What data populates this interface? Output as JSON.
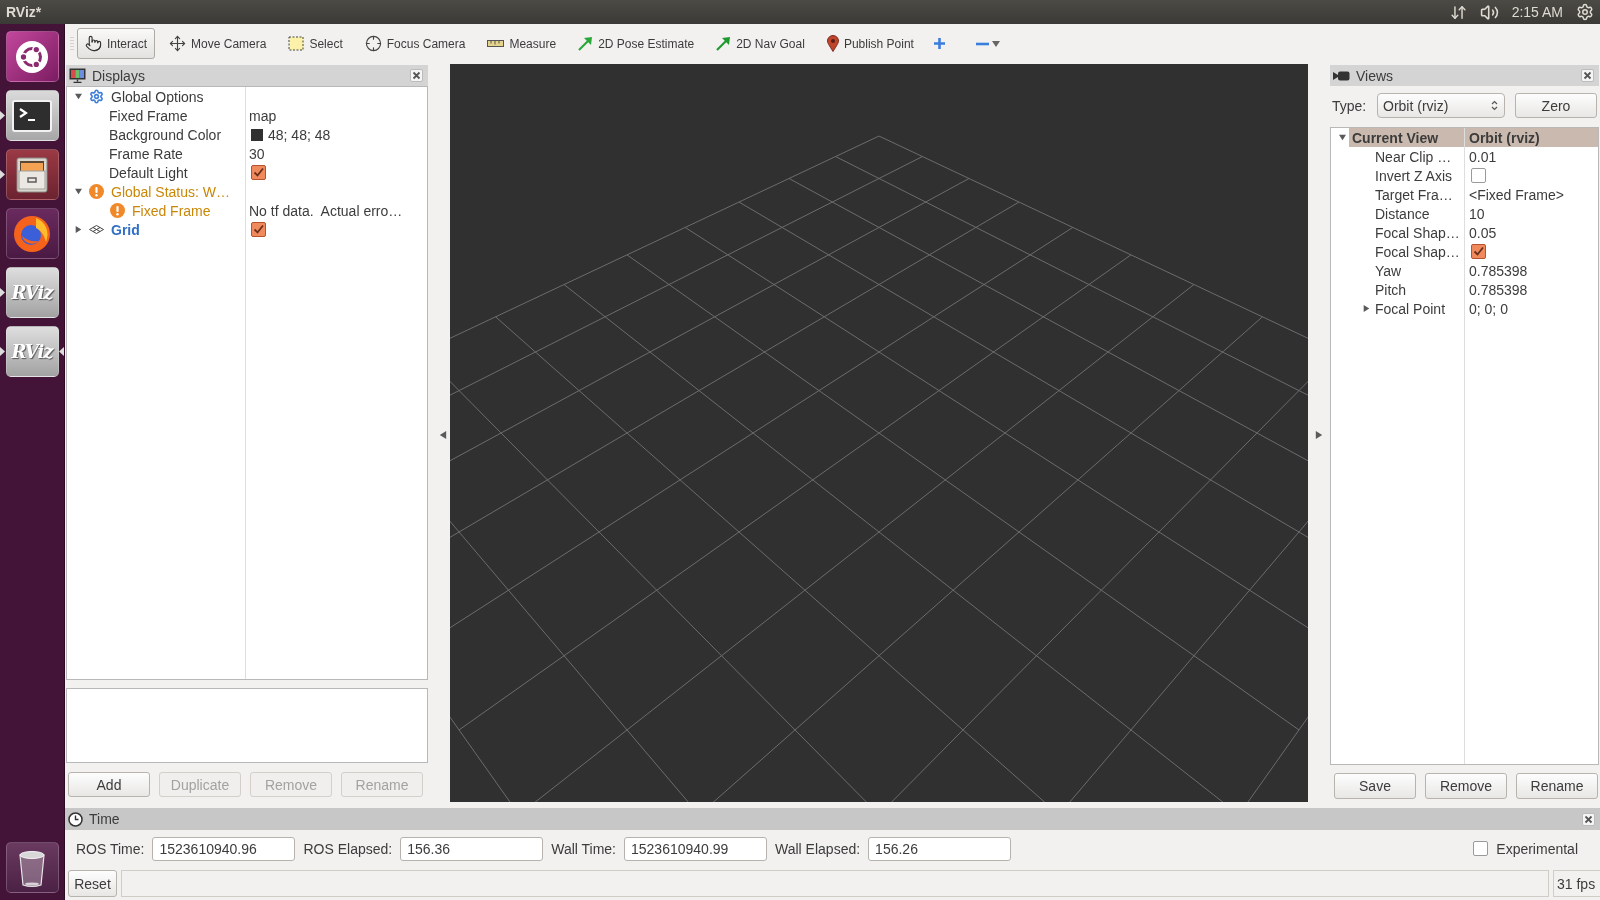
{
  "top_bar": {
    "title": "RViz*",
    "clock": "2:15 AM"
  },
  "launcher": {
    "items": [
      {
        "kind": "dash",
        "running": false,
        "active": false
      },
      {
        "kind": "terminal",
        "running": true,
        "active": false
      },
      {
        "kind": "files",
        "running": true,
        "active": false
      },
      {
        "kind": "browser",
        "running": false,
        "active": false
      },
      {
        "kind": "rviz",
        "label": "RViz",
        "running": true,
        "active": false
      },
      {
        "kind": "rviz",
        "label": "RViz",
        "running": true,
        "active": true
      },
      {
        "kind": "trash",
        "running": false,
        "active": false
      }
    ]
  },
  "toolbar": {
    "tools": [
      {
        "kind": "interact",
        "label": "Interact",
        "selected": true
      },
      {
        "kind": "move_camera",
        "label": "Move Camera",
        "selected": false
      },
      {
        "kind": "select",
        "label": "Select",
        "selected": false
      },
      {
        "kind": "focus_camera",
        "label": "Focus Camera",
        "selected": false
      },
      {
        "kind": "measure",
        "label": "Measure",
        "selected": false
      },
      {
        "kind": "pose",
        "label": "2D Pose Estimate",
        "selected": false
      },
      {
        "kind": "goal",
        "label": "2D Nav Goal",
        "selected": false
      },
      {
        "kind": "point",
        "label": "Publish Point",
        "selected": false
      }
    ]
  },
  "displays": {
    "title": "Displays",
    "tree": [
      {
        "name": "Global Options",
        "kind": "options",
        "expanded": true,
        "children": [
          {
            "name": "Fixed Frame",
            "kind": "text",
            "value": "map"
          },
          {
            "name": "Background Color",
            "kind": "color",
            "value": "48; 48; 48",
            "color": "#303030"
          },
          {
            "name": "Frame Rate",
            "kind": "text",
            "value": "30"
          },
          {
            "name": "Default Light",
            "kind": "checkbox",
            "checked": true
          }
        ]
      },
      {
        "name": "Global Status: W…",
        "kind": "status",
        "warning": true,
        "expanded": true,
        "children": [
          {
            "name": "Fixed Frame",
            "kind": "status",
            "warning": true,
            "value": "No tf data.  Actual erro…"
          }
        ]
      },
      {
        "name": "Grid",
        "kind": "display",
        "expanded": false,
        "checked": true
      }
    ],
    "buttons": [
      {
        "label": "Add",
        "disabled": false
      },
      {
        "label": "Duplicate",
        "disabled": true
      },
      {
        "label": "Remove",
        "disabled": true
      },
      {
        "label": "Rename",
        "disabled": true
      }
    ]
  },
  "views": {
    "title": "Views",
    "type_label": "Type:",
    "type_value": "Orbit (rviz)",
    "zero_button": "Zero",
    "tree": [
      {
        "name": "Current View",
        "kind": "category",
        "value": "Orbit (rviz)",
        "expanded": true,
        "children": [
          {
            "name": "Near Clip …",
            "kind": "text",
            "value": "0.01"
          },
          {
            "name": "Invert Z Axis",
            "kind": "checkbox",
            "checked": false
          },
          {
            "name": "Target Fra…",
            "kind": "text",
            "value": "<Fixed Frame>"
          },
          {
            "name": "Distance",
            "kind": "text",
            "value": "10"
          },
          {
            "name": "Focal Shap…",
            "kind": "text",
            "value": "0.05"
          },
          {
            "name": "Focal Shap…",
            "kind": "checkbox",
            "checked": true
          },
          {
            "name": "Yaw",
            "kind": "text",
            "value": "0.785398"
          },
          {
            "name": "Pitch",
            "kind": "text",
            "value": "0.785398"
          },
          {
            "name": "Focal Point",
            "kind": "text",
            "expanded": false,
            "value": "0; 0; 0"
          }
        ]
      }
    ],
    "buttons": [
      {
        "label": "Save",
        "disabled": false
      },
      {
        "label": "Remove",
        "disabled": false
      },
      {
        "label": "Rename",
        "disabled": false
      }
    ]
  },
  "time": {
    "title": "Time",
    "fields": [
      {
        "label": "ROS Time:",
        "value": "1523610940.96"
      },
      {
        "label": "ROS Elapsed:",
        "value": "156.36"
      },
      {
        "label": "Wall Time:",
        "value": "1523610940.99"
      },
      {
        "label": "Wall Elapsed:",
        "value": "156.26"
      }
    ],
    "experimental": {
      "label": "Experimental",
      "checked": false
    }
  },
  "status_bar": {
    "reset_button": "Reset",
    "fps": "31 fps"
  }
}
